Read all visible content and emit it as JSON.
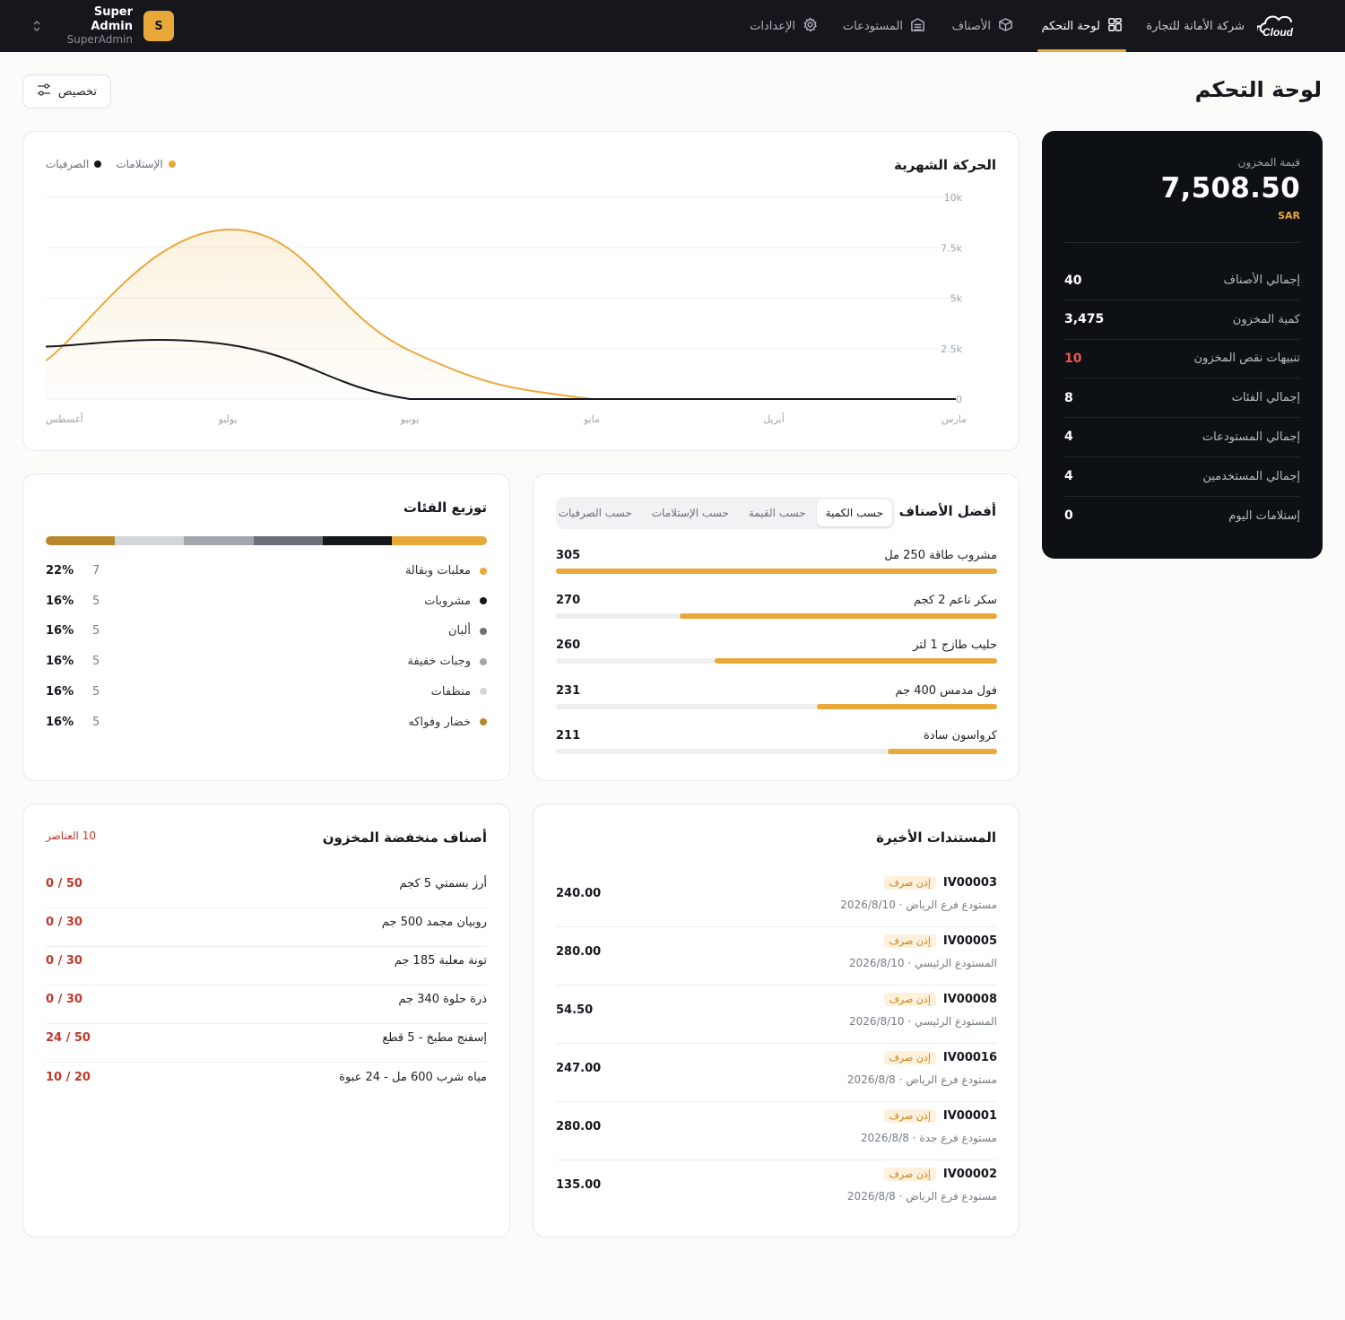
{
  "nav": {
    "brand_name": "شركة الأمانة للتجارة",
    "logo_text": "EMTCloud",
    "tabs": [
      {
        "label": "لوحة التحكم",
        "icon": "dashboard-icon",
        "active": true
      },
      {
        "label": "الأصناف",
        "icon": "box-icon",
        "active": false
      },
      {
        "label": "المستودعات",
        "icon": "warehouse-icon",
        "active": false
      },
      {
        "label": "الإعدادات",
        "icon": "gear-icon",
        "active": false
      }
    ],
    "user": {
      "name": "Super Admin",
      "role": "SuperAdmin",
      "initial": "S"
    }
  },
  "page": {
    "title": "لوحة التحكم",
    "customize_label": "تخصيص"
  },
  "stats": {
    "value_label": "قيمة المخزون",
    "value": "7,508.50",
    "currency": "SAR",
    "rows": [
      {
        "label": "إجمالي الأصناف",
        "value": "40",
        "alert": false
      },
      {
        "label": "كمية المخزون",
        "value": "3,475",
        "alert": false
      },
      {
        "label": "تنبيهات نقص المخزون",
        "value": "10",
        "alert": true
      },
      {
        "label": "إجمالي الفئات",
        "value": "8",
        "alert": false
      },
      {
        "label": "إجمالي المستودعات",
        "value": "4",
        "alert": false
      },
      {
        "label": "إجمالي المستخدمين",
        "value": "4",
        "alert": false
      },
      {
        "label": "إستلامات اليوم",
        "value": "0",
        "alert": false
      }
    ]
  },
  "chart_data": {
    "type": "area",
    "title": "الحركة الشهرية",
    "categories": [
      "مارس",
      "أبريل",
      "مايو",
      "يونيو",
      "يوليو",
      "أغسطس"
    ],
    "series": [
      {
        "name": "الإستلامات",
        "color": "#e9a93a",
        "values": [
          0,
          0,
          0,
          2400,
          8400,
          1900
        ]
      },
      {
        "name": "الصرفيات",
        "color": "#15171c",
        "values": [
          0,
          0,
          0,
          0,
          2700,
          2600
        ]
      }
    ],
    "y_ticks": [
      "0",
      "2.5k",
      "5k",
      "7.5k",
      "10k"
    ],
    "ylim": [
      0,
      10000
    ],
    "legend": "top-left",
    "grid": true
  },
  "top_products": {
    "title": "أفضل الأصناف",
    "tabs": [
      {
        "label": "حسب الكمية",
        "active": true
      },
      {
        "label": "حسب القيمة",
        "active": false
      },
      {
        "label": "حسب الإستلامات",
        "active": false
      },
      {
        "label": "حسب الصرفيات",
        "active": false
      }
    ],
    "max": 305,
    "items": [
      {
        "name": "مشروب طاقة 250 مل",
        "value": 305
      },
      {
        "name": "سكر ناعم 2 كجم",
        "value": 270
      },
      {
        "name": "حليب طازج 1 لتر",
        "value": 260
      },
      {
        "name": "فول مدمس 400 جم",
        "value": 231
      },
      {
        "name": "كرواسون سادة",
        "value": 211
      }
    ]
  },
  "categories": {
    "title": "توزيع الفئات",
    "items": [
      {
        "name": "معلبات وبقالة",
        "count": "7",
        "pct": "22%",
        "share": 22,
        "color": "#e9a93a"
      },
      {
        "name": "مشروبات",
        "count": "5",
        "pct": "16%",
        "share": 16,
        "color": "#15171c"
      },
      {
        "name": "ألبان",
        "count": "5",
        "pct": "16%",
        "share": 16,
        "color": "#6b7079"
      },
      {
        "name": "وجبات خفيفة",
        "count": "5",
        "pct": "16%",
        "share": 16,
        "color": "#a3a7ad"
      },
      {
        "name": "منظفات",
        "count": "5",
        "pct": "16%",
        "share": 16,
        "color": "#d3d5d8"
      },
      {
        "name": "خضار وفواكه",
        "count": "5",
        "pct": "16%",
        "share": 16,
        "color": "#b8872b"
      }
    ]
  },
  "recent_docs": {
    "title": "المستندات الأخيرة",
    "items": [
      {
        "id": "IV00003",
        "type": "إذن صرف",
        "sub": "مستودع فرع الرياض · 2026/8/10",
        "amount": "240.00"
      },
      {
        "id": "IV00005",
        "type": "إذن صرف",
        "sub": "المستودع الرئيسي · 2026/8/10",
        "amount": "280.00"
      },
      {
        "id": "IV00008",
        "type": "إذن صرف",
        "sub": "المستودع الرئيسي · 2026/8/10",
        "amount": "54.50"
      },
      {
        "id": "IV00016",
        "type": "إذن صرف",
        "sub": "مستودع فرع الرياض · 2026/8/8",
        "amount": "247.00"
      },
      {
        "id": "IV00001",
        "type": "إذن صرف",
        "sub": "مستودع فرع جدة · 2026/8/8",
        "amount": "280.00"
      },
      {
        "id": "IV00002",
        "type": "إذن صرف",
        "sub": "مستودع فرع الرياض · 2026/8/8",
        "amount": "135.00"
      }
    ]
  },
  "low_stock": {
    "title": "أصناف منخفضة المخزون",
    "count_label": "10 العناصر",
    "items": [
      {
        "name": "أرز بسمتي 5 كجم",
        "qty": "0 / 50"
      },
      {
        "name": "روبيان مجمد 500 جم",
        "qty": "0 / 30"
      },
      {
        "name": "تونة معلبة 185 جم",
        "qty": "0 / 30"
      },
      {
        "name": "ذرة حلوة 340 جم",
        "qty": "0 / 30"
      },
      {
        "name": "إسفنج مطبخ - 5 قطع",
        "qty": "24 / 50"
      },
      {
        "name": "مياه شرب 600 مل - 24 عبوة",
        "qty": "10 / 20"
      }
    ]
  }
}
